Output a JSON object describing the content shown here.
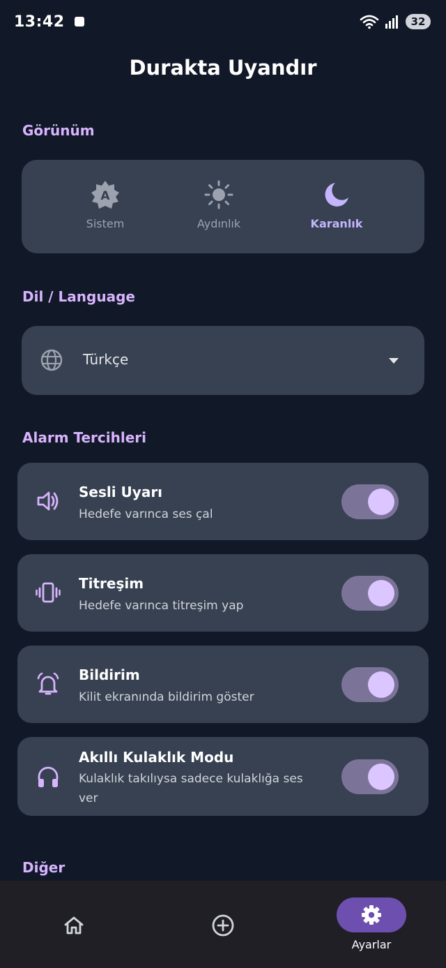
{
  "status_bar": {
    "time": "13:42",
    "battery": "32",
    "icons": [
      "wifi-icon",
      "signal-icon",
      "battery-icon"
    ]
  },
  "app": {
    "title": "Durakta Uyandır"
  },
  "appearance": {
    "section_title": "Görünüm",
    "options": [
      {
        "label": "Sistem",
        "icon": "brightness-auto-icon",
        "selected": false
      },
      {
        "label": "Aydınlık",
        "icon": "sun-icon",
        "selected": false
      },
      {
        "label": "Karanlık",
        "icon": "moon-icon",
        "selected": true
      }
    ]
  },
  "language": {
    "section_title": "Dil / Language",
    "selected": "Türkçe",
    "icon": "globe-icon"
  },
  "alarm_prefs": {
    "section_title": "Alarm Tercihleri",
    "items": [
      {
        "title": "Sesli Uyarı",
        "description": "Hedefe varınca ses çal",
        "icon": "volume-icon",
        "enabled": true
      },
      {
        "title": "Titreşim",
        "description": "Hedefe varınca titreşim yap",
        "icon": "vibration-icon",
        "enabled": true
      },
      {
        "title": "Bildirim",
        "description": "Kilit ekranında bildirim göster",
        "icon": "alarm-bell-icon",
        "enabled": true
      },
      {
        "title": "Akıllı Kulaklık Modu",
        "description": "Kulaklık takılıysa sadece kulaklığa ses ver",
        "icon": "headphones-icon",
        "enabled": true
      }
    ]
  },
  "other": {
    "section_title": "Diğer"
  },
  "bottom_nav": {
    "items": [
      {
        "icon": "home-icon",
        "label": ""
      },
      {
        "icon": "add-circle-icon",
        "label": ""
      },
      {
        "icon": "gear-icon",
        "label": "Ayarlar",
        "active": true
      }
    ]
  },
  "colors": {
    "background": "#111827",
    "card": "#374151",
    "accent": "#d8b4fe",
    "toggle_track": "#7c7399",
    "toggle_knob": "#dcc6ff",
    "nav_active": "#6d4fb0"
  }
}
